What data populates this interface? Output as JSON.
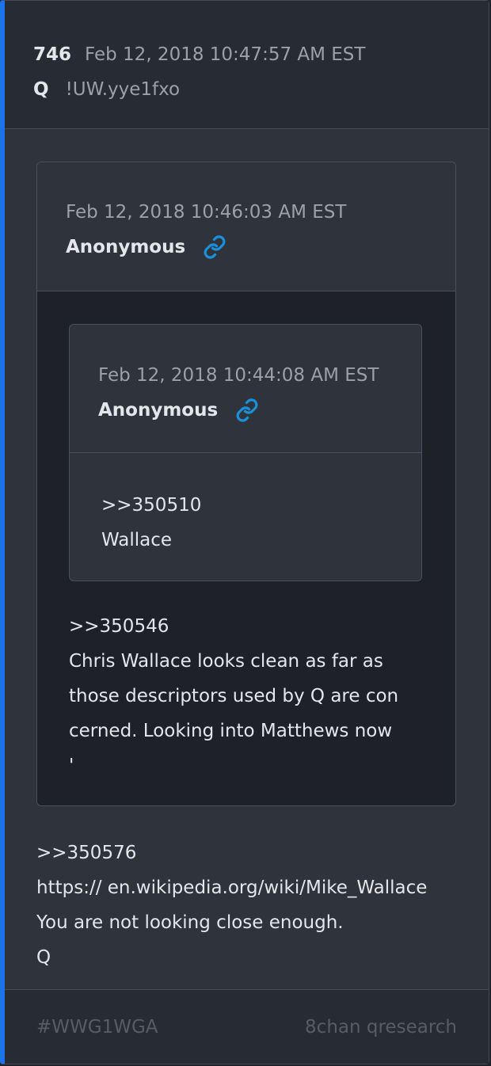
{
  "post": {
    "number": "746",
    "timestamp": "Feb 12, 2018 10:47:57 AM EST",
    "author": "Q",
    "tripcode": "!UW.yye1fxo"
  },
  "quote_outer": {
    "timestamp": "Feb 12, 2018 10:46:03 AM EST",
    "author": "Anonymous",
    "body": ">>350546",
    "lines": [
      "Chris Wallace looks clean as far as",
      "those descriptors used by Q are con",
      "cerned. Looking into Matthews now",
      "'"
    ]
  },
  "quote_inner": {
    "timestamp": "Feb 12, 2018 10:44:08 AM EST",
    "author": "Anonymous",
    "ref": ">>350510",
    "text": "Wallace"
  },
  "message": {
    "ref": ">>350576",
    "link": "https:// en.wikipedia.org/wiki/Mike_Wallace",
    "line1": "You are not looking close enough.",
    "sign": "Q"
  },
  "footer": {
    "tag": "#WWG1WGA",
    "source": "8chan qresearch"
  },
  "colors": {
    "accent": "#1a73e8",
    "link_icon": "#1b8fd8"
  },
  "icons": {
    "outer_link": "link-icon",
    "inner_link": "link-icon"
  }
}
